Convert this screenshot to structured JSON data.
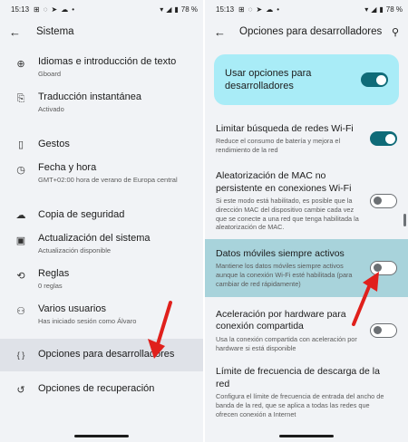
{
  "status": {
    "time": "15:13",
    "battery": "78 %"
  },
  "left": {
    "title": "Sistema",
    "items": [
      {
        "icon": "globe-icon",
        "glyph": "⊕",
        "label": "Idiomas e introducción de texto",
        "sub": "Gboard"
      },
      {
        "icon": "translate-icon",
        "glyph": "⎘",
        "label": "Traducción instantánea",
        "sub": "Activado"
      },
      {
        "icon": "gesture-phone-icon",
        "glyph": "▯",
        "label": "Gestos",
        "sub": ""
      },
      {
        "icon": "clock-icon",
        "glyph": "◷",
        "label": "Fecha y hora",
        "sub": "GMT+02:00 hora de verano de Europa central"
      },
      {
        "icon": "cloud-upload-icon",
        "glyph": "☁",
        "label": "Copia de seguridad",
        "sub": ""
      },
      {
        "icon": "system-update-icon",
        "glyph": "▣",
        "label": "Actualización del sistema",
        "sub": "Actualización disponible"
      },
      {
        "icon": "rules-icon",
        "glyph": "⟲",
        "label": "Reglas",
        "sub": "0 reglas"
      },
      {
        "icon": "users-icon",
        "glyph": "⚇",
        "label": "Varios usuarios",
        "sub": "Has iniciado sesión como Álvaro"
      },
      {
        "icon": "braces-icon",
        "glyph": "{ }",
        "label": "Opciones para desarrolladores",
        "sub": ""
      },
      {
        "icon": "history-icon",
        "glyph": "↺",
        "label": "Opciones de recuperación",
        "sub": ""
      }
    ]
  },
  "right": {
    "title": "Opciones para desarrolladores",
    "banner": {
      "label": "Usar opciones para desarrolladores",
      "on": true
    },
    "items": [
      {
        "label": "Limitar búsqueda de redes Wi-Fi",
        "sub": "Reduce el consumo de batería y mejora el rendimiento de la red",
        "on": true
      },
      {
        "label": "Aleatorización de MAC no persistente en conexiones Wi-Fi",
        "sub": "Si este modo está habilitado, es posible que la dirección MAC del dispositivo cambie cada vez que se conecte a una red que tenga habilitada la aleatorización de MAC.",
        "on": false
      },
      {
        "label": "Datos móviles siempre activos",
        "sub": "Mantiene los datos móviles siempre activos aunque la conexión Wi-Fi esté habilitada (para cambiar de red rápidamente)",
        "on": false
      },
      {
        "label": "Aceleración por hardware para conexión compartida",
        "sub": "Usa la conexión compartida con aceleración por hardware si está disponible",
        "on": false
      },
      {
        "label": "Límite de frecuencia de descarga de la red",
        "sub": "Configura el límite de frecuencia de entrada del ancho de banda de la red, que se aplica a todas las redes que ofrecen conexión a Internet"
      }
    ]
  },
  "colors": {
    "toggle_on": "#0f6b78",
    "banner": "#a9ecf7",
    "highlight_left": "#dfe2e8",
    "highlight_right": "#a8d3db",
    "arrow": "#e0201c"
  }
}
